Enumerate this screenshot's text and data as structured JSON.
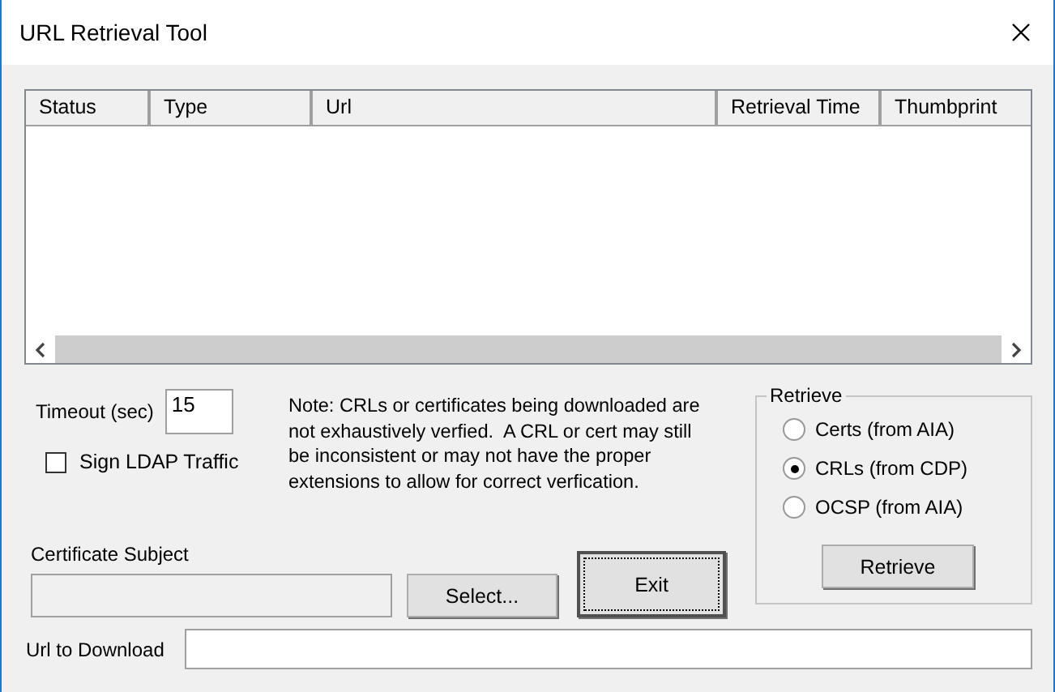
{
  "window": {
    "title": "URL Retrieval Tool"
  },
  "table": {
    "columns": [
      {
        "label": "Status"
      },
      {
        "label": "Type"
      },
      {
        "label": "Url"
      },
      {
        "label": "Retrieval Time"
      },
      {
        "label": "Thumbprint"
      }
    ]
  },
  "timeout": {
    "label": "Timeout (sec)",
    "value": "15"
  },
  "sign_ldap": {
    "label": "Sign LDAP Traffic",
    "checked": false
  },
  "note": "Note: CRLs or certificates being downloaded are not exhaustively verfied.  A CRL or cert may still be inconsistent or may not have the proper extensions to allow for correct verfication.",
  "certificate_subject": {
    "label": "Certificate Subject",
    "disabled": true
  },
  "select_button": "Select...",
  "exit_button": {
    "label": "Exit",
    "focused": true
  },
  "retrieve_group": {
    "title": "Retrieve",
    "options": [
      {
        "label": "Certs (from AIA)",
        "selected": false
      },
      {
        "label": "CRLs (from CDP)",
        "selected": true
      },
      {
        "label": "OCSP (from AIA)",
        "selected": false
      }
    ],
    "button": "Retrieve"
  },
  "url_to_download": {
    "label": "Url to Download"
  }
}
